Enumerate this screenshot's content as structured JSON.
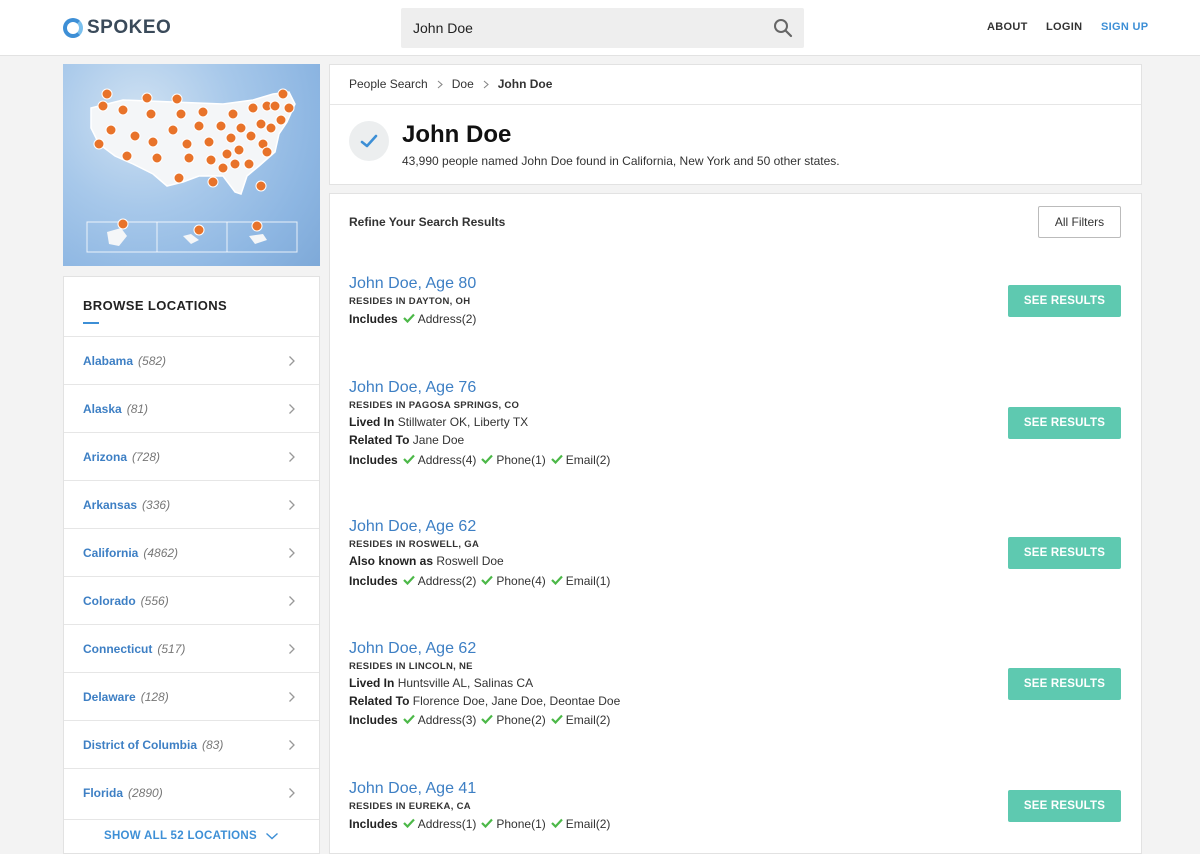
{
  "brand": {
    "name": "SPOKEO",
    "accent": "#3d8fd6",
    "button_color": "#5ec9b0"
  },
  "search": {
    "value": "John Doe",
    "placeholder": ""
  },
  "nav": {
    "about": "ABOUT",
    "login": "LOGIN",
    "signup": "SIGN UP"
  },
  "sidebar": {
    "title": "BROWSE LOCATIONS",
    "locations": [
      {
        "name": "Alabama",
        "count": "(582)"
      },
      {
        "name": "Alaska",
        "count": "(81)"
      },
      {
        "name": "Arizona",
        "count": "(728)"
      },
      {
        "name": "Arkansas",
        "count": "(336)"
      },
      {
        "name": "California",
        "count": "(4862)"
      },
      {
        "name": "Colorado",
        "count": "(556)"
      },
      {
        "name": "Connecticut",
        "count": "(517)"
      },
      {
        "name": "Delaware",
        "count": "(128)"
      },
      {
        "name": "District of Columbia",
        "count": "(83)"
      },
      {
        "name": "Florida",
        "count": "(2890)"
      }
    ],
    "show_all": "SHOW ALL 52 LOCATIONS"
  },
  "breadcrumb": [
    "People Search",
    "Doe",
    "John Doe"
  ],
  "header": {
    "title": "John Doe",
    "subtitle": "43,990 people named John Doe found in California, New York and 50 other states."
  },
  "refine": {
    "label": "Refine Your Search Results",
    "filters_button": "All Filters"
  },
  "results": [
    {
      "name": "John Doe, Age 80",
      "resides": "RESIDES IN DAYTON, OH",
      "lived_in": null,
      "related_to": null,
      "also_known_as": null,
      "includes": [
        "Address(2)"
      ],
      "button": "SEE RESULTS"
    },
    {
      "name": "John Doe, Age 76",
      "resides": "RESIDES IN PAGOSA SPRINGS, CO",
      "lived_in": "Stillwater OK, Liberty TX",
      "related_to": "Jane Doe",
      "also_known_as": null,
      "includes": [
        "Address(4)",
        "Phone(1)",
        "Email(2)"
      ],
      "button": "SEE RESULTS"
    },
    {
      "name": "John Doe, Age 62",
      "resides": "RESIDES IN ROSWELL, GA",
      "lived_in": null,
      "related_to": null,
      "also_known_as": "Roswell Doe",
      "includes": [
        "Address(2)",
        "Phone(4)",
        "Email(1)"
      ],
      "button": "SEE RESULTS"
    },
    {
      "name": "John Doe, Age 62",
      "resides": "RESIDES IN LINCOLN, NE",
      "lived_in": "Huntsville AL, Salinas CA",
      "related_to": "Florence Doe, Jane Doe, Deontae Doe",
      "also_known_as": null,
      "includes": [
        "Address(3)",
        "Phone(2)",
        "Email(2)"
      ],
      "button": "SEE RESULTS"
    },
    {
      "name": "John Doe, Age 41",
      "resides": "RESIDES IN EUREKA, CA",
      "lived_in": null,
      "related_to": null,
      "also_known_as": null,
      "includes": [
        "Address(1)",
        "Phone(1)",
        "Email(2)"
      ],
      "button": "SEE RESULTS"
    }
  ],
  "labels": {
    "lived_in": "Lived In",
    "related_to": "Related To",
    "also_known_as": "Also known as",
    "includes": "Includes"
  }
}
